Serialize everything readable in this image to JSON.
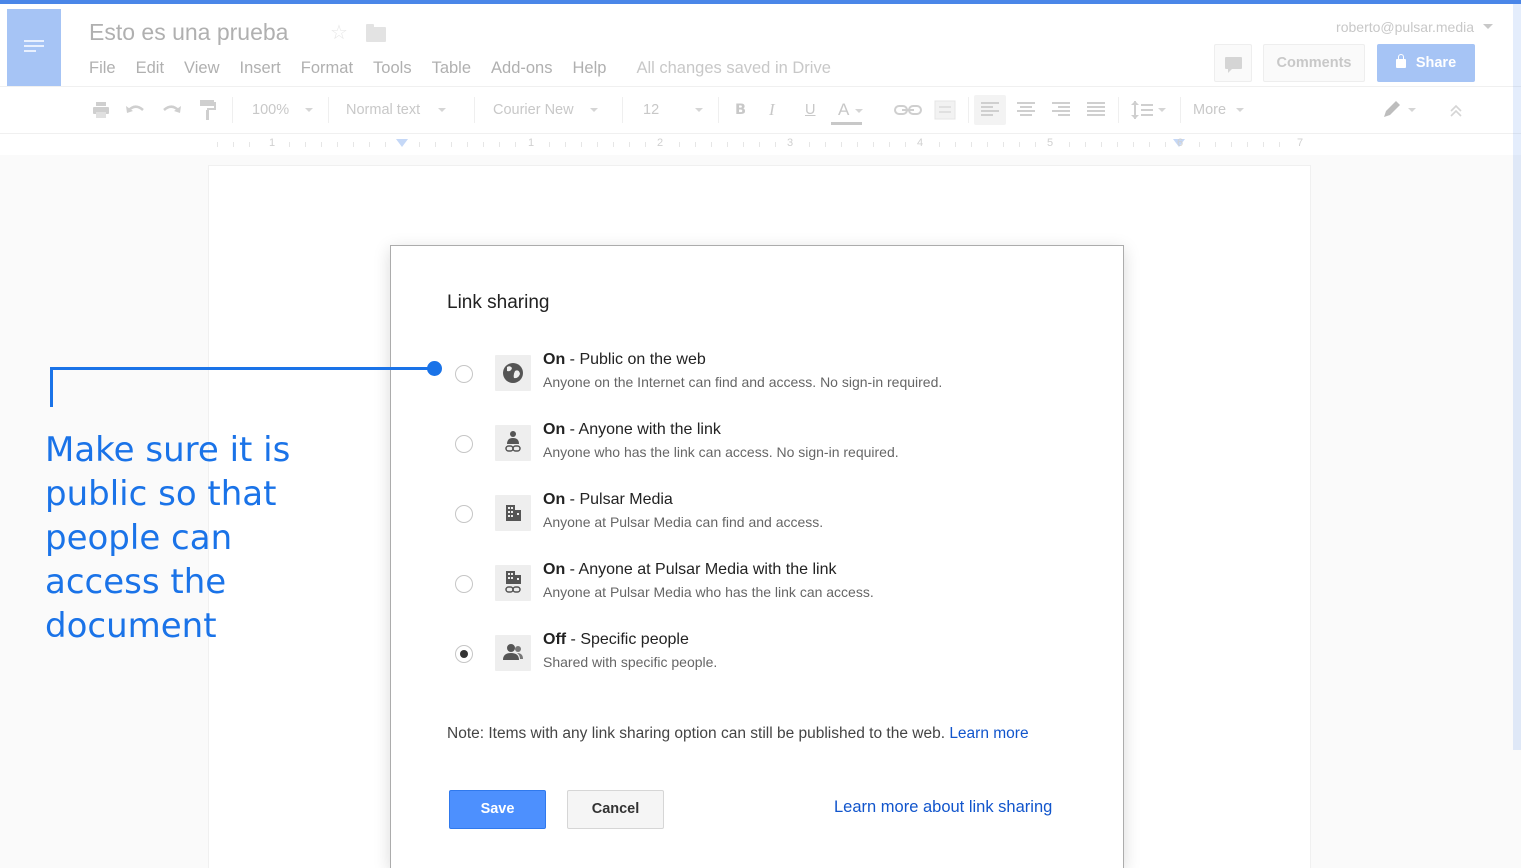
{
  "document": {
    "title": "Esto es una prueba",
    "user_email": "roberto@pulsar.media"
  },
  "menu": {
    "items": [
      "File",
      "Edit",
      "View",
      "Insert",
      "Format",
      "Tools",
      "Table",
      "Add-ons",
      "Help"
    ],
    "status": "All changes saved in Drive"
  },
  "header_buttons": {
    "comments_label": "Comments",
    "share_label": "Share"
  },
  "toolbar": {
    "zoom": "100%",
    "style": "Normal text",
    "font": "Courier New",
    "size": "12",
    "bold": "B",
    "italic": "I",
    "underline": "U",
    "text_color": "A",
    "more_label": "More"
  },
  "ruler": {
    "numbers": [
      "1",
      "1",
      "2",
      "3",
      "4",
      "5",
      "6",
      "7"
    ]
  },
  "dialog": {
    "title": "Link sharing",
    "options": [
      {
        "state": "On",
        "label": " - Public on the web",
        "description": "Anyone on the Internet can find and access. No sign-in required.",
        "icon": "globe-icon",
        "selected": false
      },
      {
        "state": "On",
        "label": " - Anyone with the link",
        "description": "Anyone who has the link can access. No sign-in required.",
        "icon": "person-link-icon",
        "selected": false
      },
      {
        "state": "On",
        "label": " - Pulsar Media",
        "description": "Anyone at Pulsar Media can find and access.",
        "icon": "building-icon",
        "selected": false
      },
      {
        "state": "On",
        "label": " - Anyone at Pulsar Media with the link",
        "description": "Anyone at Pulsar Media who has the link can access.",
        "icon": "building-link-icon",
        "selected": false
      },
      {
        "state": "Off",
        "label": " - Specific people",
        "description": "Shared with specific people.",
        "icon": "people-icon",
        "selected": true
      }
    ],
    "note": "Note: Items with any link sharing option can still be published to the web. ",
    "note_link": "Learn more",
    "save_label": "Save",
    "cancel_label": "Cancel",
    "learn_more_link": "Learn more about link sharing"
  },
  "annotation": {
    "text": "Make sure it is public so that people can access the document"
  },
  "colors": {
    "accent": "#1a73e8",
    "share_button": "#a6c4f5",
    "save_button": "#4d90fe",
    "link": "#1155cc"
  }
}
